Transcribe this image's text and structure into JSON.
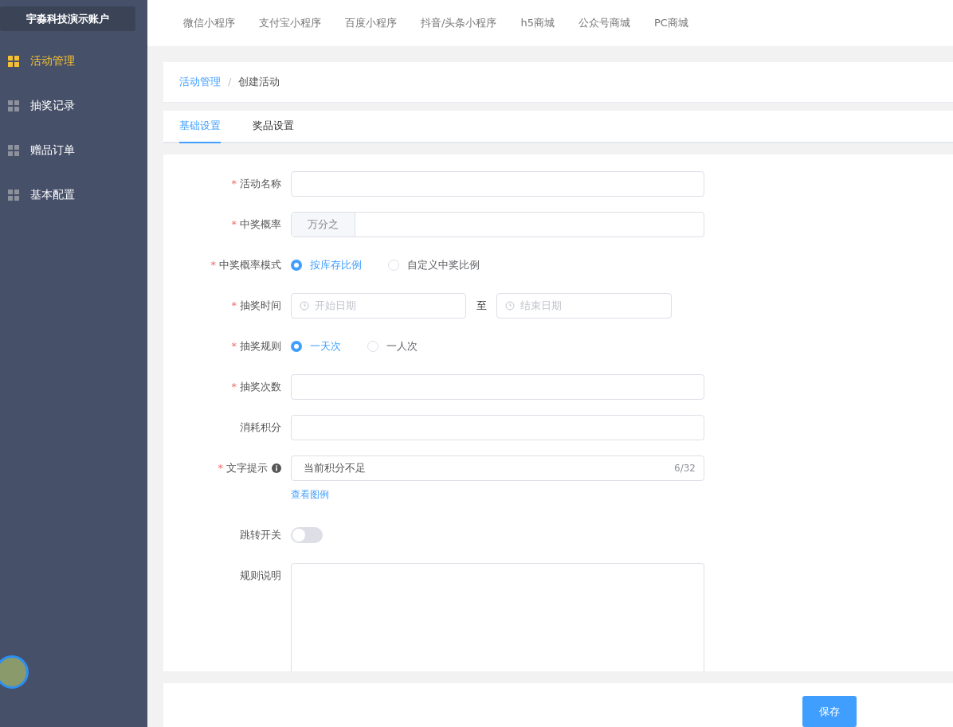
{
  "sidebar": {
    "account": "宇淼科技演示账户",
    "items": [
      {
        "label": "活动管理",
        "selected": true
      },
      {
        "label": "抽奖记录",
        "selected": false
      },
      {
        "label": "赠品订单",
        "selected": false
      },
      {
        "label": "基本配置",
        "selected": false
      }
    ]
  },
  "top_nav": [
    "微信小程序",
    "支付宝小程序",
    "百度小程序",
    "抖音/头条小程序",
    "h5商城",
    "公众号商城",
    "PC商城"
  ],
  "breadcrumb": {
    "separator": "/",
    "items": [
      {
        "label": "活动管理",
        "kind": "link"
      },
      {
        "label": "创建活动",
        "kind": "current"
      }
    ]
  },
  "tabs": [
    {
      "label": "基础设置",
      "selected": true
    },
    {
      "label": "奖品设置",
      "selected": false
    }
  ],
  "form": [
    {
      "kind": "text",
      "label": "活动名称",
      "required_mark": "*"
    },
    {
      "kind": "prepend",
      "label": "中奖概率",
      "required_mark": "*",
      "prepend": "万分之"
    },
    {
      "kind": "radio",
      "label": "中奖概率模式",
      "required_mark": "*",
      "options": [
        {
          "label": "按库存比例",
          "selected": true
        },
        {
          "label": "自定义中奖比例",
          "selected": false
        }
      ]
    },
    {
      "kind": "daterange",
      "label": "抽奖时间",
      "required_mark": "*",
      "start_placeholder": "开始日期",
      "separator": "至",
      "end_placeholder": "结束日期"
    },
    {
      "kind": "radio",
      "label": "抽奖规则",
      "required_mark": "*",
      "options": [
        {
          "label": "一天次",
          "selected": true
        },
        {
          "label": "一人次",
          "selected": false
        }
      ]
    },
    {
      "kind": "text",
      "label": "抽奖次数",
      "required_mark": "*"
    },
    {
      "kind": "text",
      "label": "消耗积分"
    },
    {
      "kind": "textcount",
      "label": "文字提示",
      "required_mark": "*",
      "info": true,
      "value": "当前积分不足",
      "count": "6/32",
      "link": "查看图例"
    },
    {
      "kind": "switch",
      "label": "跳转开关",
      "on": false
    },
    {
      "kind": "textarea",
      "label": "规则说明"
    }
  ],
  "save_button": "保存"
}
